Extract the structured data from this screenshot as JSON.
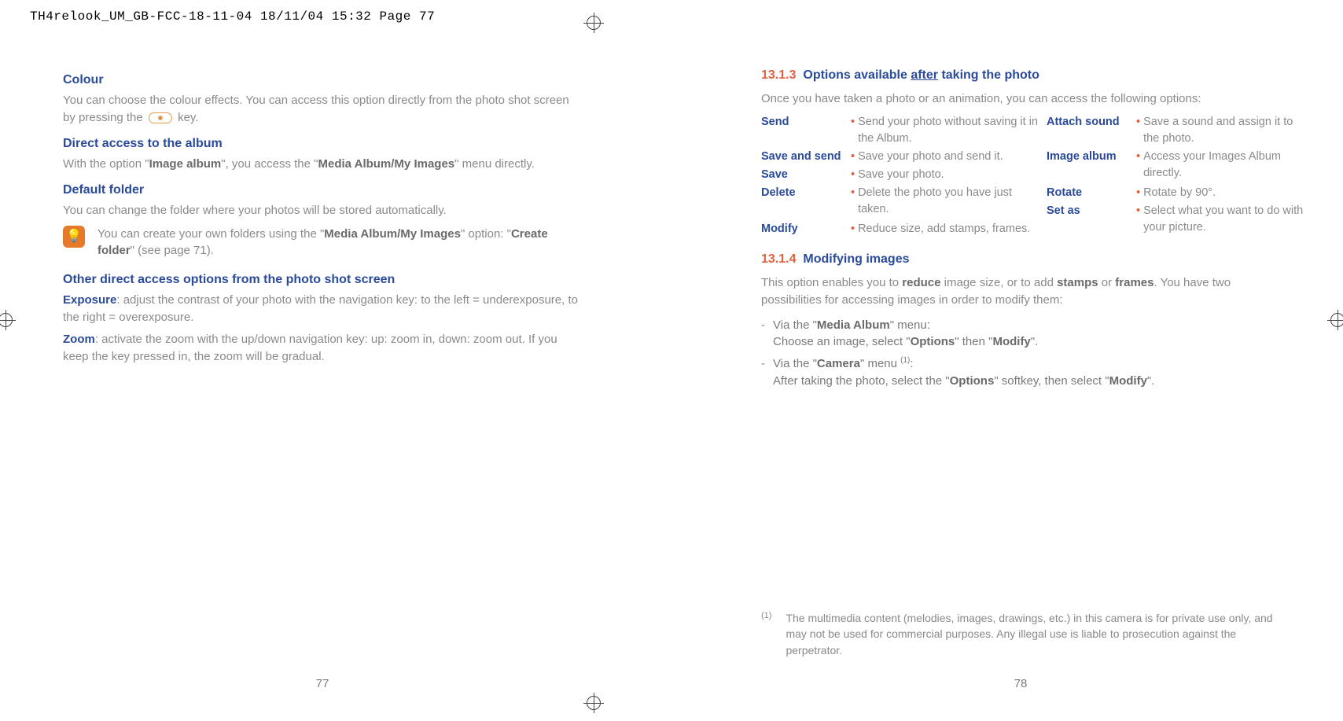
{
  "slug": "TH4relook_UM_GB-FCC-18-11-04  18/11/04  15:32  Page 77",
  "left": {
    "h_colour": "Colour",
    "p_colour_a": "You can choose the colour effects. You can access this option directly from the photo shot screen by pressing the ",
    "p_colour_b": " key.",
    "h_direct": "Direct access to the album",
    "p_direct_a": "With the option \"",
    "p_direct_b": "Image album",
    "p_direct_c": "\", you access the \"",
    "p_direct_d": "Media Album/My Images",
    "p_direct_e": "\" menu directly.",
    "h_default": "Default folder",
    "p_default": "You can change the folder where your photos will be stored automatically.",
    "tip_a": "You can create your own folders using the \"",
    "tip_b": "Media Album/My Images",
    "tip_c": "\" option: \"",
    "tip_d": "Create folder",
    "tip_e": "\" (see page 71).",
    "h_other": "Other direct access options from the photo shot screen",
    "exp_label": "Exposure",
    "exp_text": ": adjust the contrast of your photo with the navigation key: to the left = underexposure, to the right = overexposure.",
    "zoom_label": "Zoom",
    "zoom_text": ": activate the zoom with the up/down navigation key: up: zoom in, down: zoom out. If you keep the key pressed in, the zoom will be gradual.",
    "page_num": "77"
  },
  "right": {
    "sec1_num": "13.1.3",
    "sec1_title_a": "Options available ",
    "sec1_title_b": "after",
    "sec1_title_c": " taking the photo",
    "intro": "Once you have taken a photo or an animation, you can access the following options:",
    "opts": {
      "send": "Send",
      "send_d": "Send your photo without saving it in the Album.",
      "savesend": "Save and send",
      "savesend_d": "Save your photo and send it.",
      "save": "Save",
      "save_d": "Save your photo.",
      "delete": "Delete",
      "delete_d": "Delete the photo you have just taken.",
      "modify": "Modify",
      "modify_d": "Reduce size, add stamps, frames.",
      "attach": "Attach sound",
      "attach_d": "Save a sound and assign it to the photo.",
      "album": "Image album",
      "album_d": "Access your Images Album directly.",
      "rotate": "Rotate",
      "rotate_d": "Rotate by 90°.",
      "setas": "Set as",
      "setas_d": "Select what you want to do with your picture."
    },
    "sec2_num": "13.1.4",
    "sec2_title": "Modifying images",
    "mod_a": "This option enables you to ",
    "mod_b": "reduce",
    "mod_c": " image size, or to add ",
    "mod_d": "stamps",
    "mod_e": " or ",
    "mod_f": "frames",
    "mod_g": ". You have two possibilities for accessing images in order to modify them:",
    "li1_a": "Via the \"",
    "li1_b": "Media Album",
    "li1_c": "\" menu:",
    "li1_d": "Choose an image, select \"",
    "li1_e": "Options",
    "li1_f": "\" then \"",
    "li1_g": "Modify",
    "li1_h": "\".",
    "li2_a": "Via the \"",
    "li2_b": "Camera",
    "li2_c": "\" menu ",
    "li2_sup": "(1)",
    "li2_d": ":",
    "li2_e": "After taking the photo, select the \"",
    "li2_f": "Options",
    "li2_g": "\" softkey, then select \"",
    "li2_h": "Modify",
    "li2_i": "\".",
    "fn_marker": "(1)",
    "fn_text": "The multimedia content (melodies, images, drawings, etc.) in this camera is for private use only, and may not be used for commercial purposes. Any illegal use is liable to prosecution against the perpetrator.",
    "page_num": "78"
  }
}
